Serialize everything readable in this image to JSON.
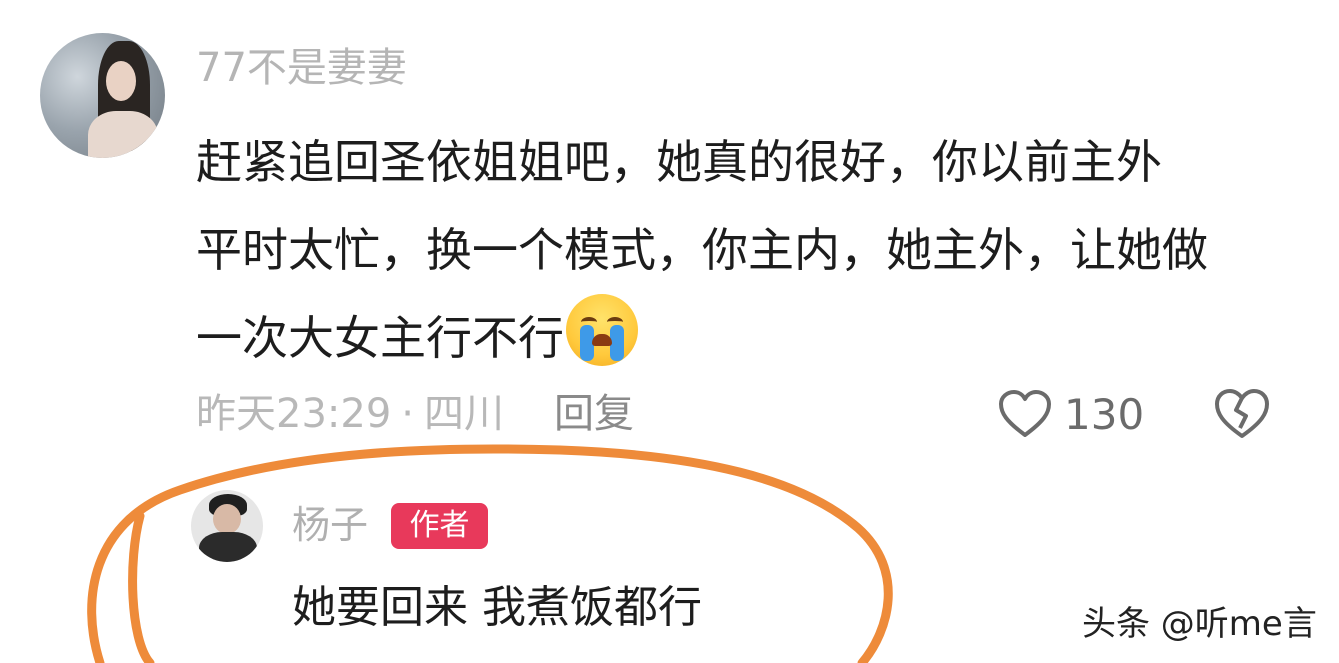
{
  "comment": {
    "username": "77不是妻妻",
    "text_lines": [
      "赶紧追回圣依姐姐吧，她真的很好，你以前主外",
      "平时太忙，换一个模式，你主内，她主外，让她做",
      "一次大女主行不行"
    ],
    "emoji": "crying-face-emoji",
    "timestamp": "昨天23:29",
    "separator": "·",
    "location": "四川",
    "reply_label": "回复",
    "like_count": "130"
  },
  "reply": {
    "username": "杨子",
    "badge": "作者",
    "text": "她要回来 我煮饭都行"
  },
  "watermark": "头条 @听me言",
  "colors": {
    "highlight_ring": "#ee8b3a",
    "author_badge": "#e8395b",
    "muted_text": "#b5b5b5",
    "body_text": "#1d1d1d"
  }
}
